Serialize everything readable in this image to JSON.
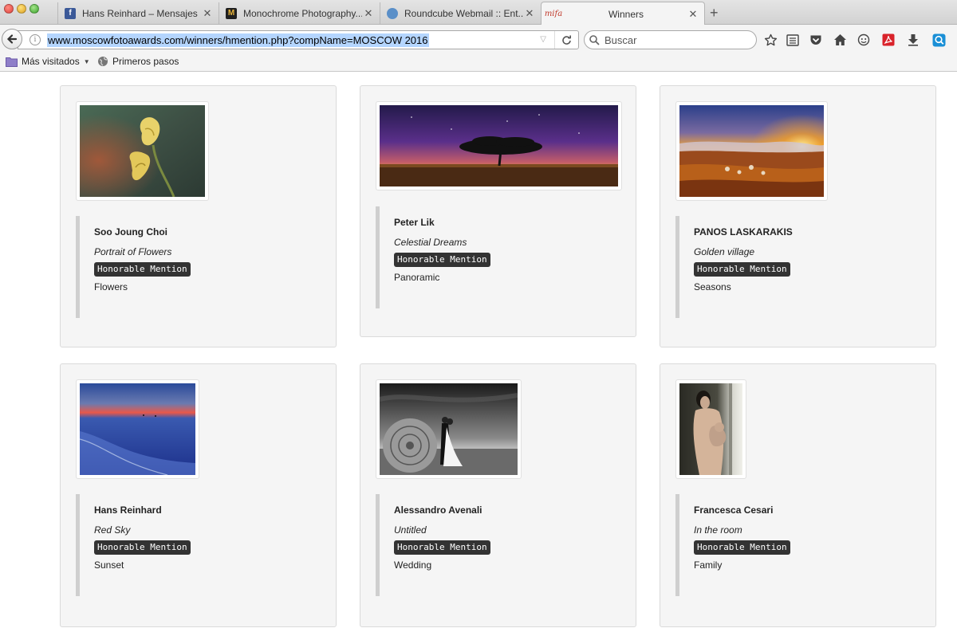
{
  "browser": {
    "tabs": [
      {
        "title": "Hans Reinhard – Mensajes",
        "favicon": "facebook-icon"
      },
      {
        "title": "Monochrome Photography...",
        "favicon": "monochrome-m-icon"
      },
      {
        "title": "Roundcube Webmail :: Ent...",
        "favicon": "roundcube-icon"
      },
      {
        "title": "Winners",
        "favicon": "mifa-icon",
        "favicon_text": "mifa",
        "active": true
      }
    ],
    "url": "www.moscowfotoawards.com/winners/hmention.php?compName=MOSCOW 2016",
    "search_placeholder": "Buscar",
    "bookmarks": [
      {
        "label": "Más visitados",
        "icon": "folder-icon"
      },
      {
        "label": "Primeros pasos",
        "icon": "globe-icon"
      }
    ]
  },
  "winners": [
    {
      "author": "Soo Joung Choi",
      "title": "Portrait of Flowers",
      "award": "Honorable Mention",
      "category": "Flowers",
      "image": "yellow-calla-lily-photo"
    },
    {
      "author": "Peter Lik",
      "title": "Celestial Dreams",
      "award": "Honorable Mention",
      "category": "Panoramic",
      "image": "tree-under-milky-way-photo"
    },
    {
      "author": "PANOS LASKARAKIS",
      "title": "Golden village",
      "award": "Honorable Mention",
      "category": "Seasons",
      "image": "autumn-village-sunset-photo"
    },
    {
      "author": "Hans Reinhard",
      "title": "Red Sky",
      "award": "Honorable Mention",
      "category": "Sunset",
      "image": "blue-sea-red-sky-photo"
    },
    {
      "author": "Alessandro Avenali",
      "title": "Untitled",
      "award": "Honorable Mention",
      "category": "Wedding",
      "image": "wedding-hay-bale-photo"
    },
    {
      "author": "Francesca Cesari",
      "title": "In the room",
      "award": "Honorable Mention",
      "category": "Family",
      "image": "mother-child-window-photo"
    }
  ]
}
